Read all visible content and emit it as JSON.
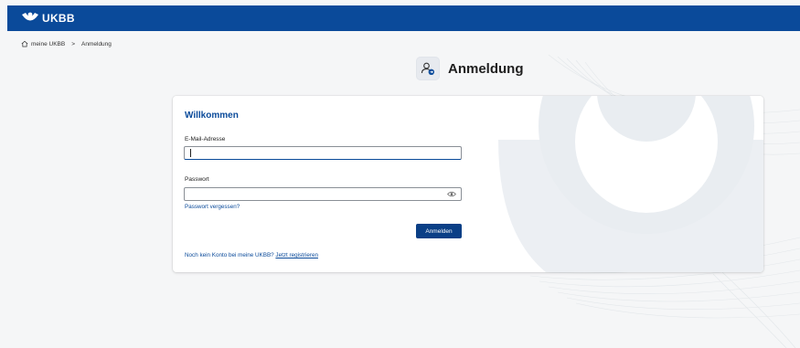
{
  "header": {
    "brand": "UKBB",
    "brand_color": "#0a4a9a"
  },
  "breadcrumb": {
    "icon": "home-icon",
    "home_label": "meine UKBB",
    "separator": ">",
    "current": "Anmeldung"
  },
  "page": {
    "title": "Anmeldung",
    "title_icon": "user-login-icon"
  },
  "form": {
    "welcome": "Willkommen",
    "email_label": "E-Mail-Adresse",
    "email_value": "",
    "password_label": "Passwort",
    "password_value": "",
    "password_toggle_icon": "eye-icon",
    "forgot_link": "Passwort vergessen?",
    "submit_label": "Anmelden",
    "submit_color": "#0a3f86",
    "register_prompt": "Noch kein Konto bei meine UKBB?",
    "register_link": "Jetzt registrieren"
  }
}
